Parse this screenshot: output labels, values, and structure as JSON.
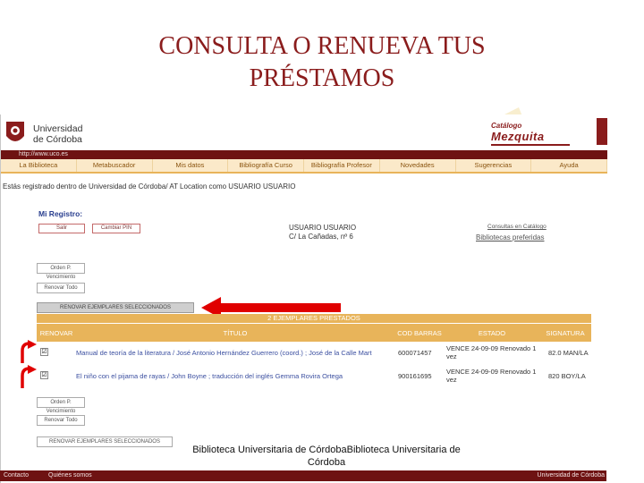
{
  "slide": {
    "title_line1": "CONSULTA O RENUEVA TUS",
    "title_line2": "PRÉSTAMOS",
    "caption": "Biblioteca Universitaria de CórdobaBiblioteca Universitaria de Córdoba"
  },
  "header": {
    "university_line1": "Universidad",
    "university_line2": "de Córdoba",
    "catalog_small": "Catálogo",
    "catalog_big": "Mezquita",
    "url": "http://www.uco.es"
  },
  "nav": {
    "items": [
      "La Biblioteca",
      "Metabuscador",
      "Mis datos",
      "Bibliografía Curso",
      "Bibliografía Profesor",
      "Novedades",
      "Sugerencias",
      "Ayuda"
    ]
  },
  "session": {
    "text": "Estás registrado dentro de Universidad de Córdoba/ AT Location como USUARIO USUARIO"
  },
  "registro": {
    "title": "Mi Registro:",
    "btn_salir": "Salir",
    "btn_cambiar_pin": "Cambiar PIN",
    "user_name": "USUARIO USUARIO",
    "user_address": "C/ La Cañadas, nº 6",
    "consultas": "Consultas en Catálogo",
    "bib_pref": "Bibliotecas preferidas",
    "btn_orden_top": "Orden P. Vencimiento",
    "btn_renovar_todo_top": "Renovar Todo",
    "btn_renovar_sel_top": "RENOVAR EJEMPLARES SELECCIONADOS",
    "btn_orden_bottom": "Orden P. Vencimiento",
    "btn_renovar_todo_bottom": "Renovar Todo",
    "btn_renovar_sel_bottom": "RENOVAR EJEMPLARES SELECCIONADOS"
  },
  "table": {
    "caption": "2 EJEMPLARES PRESTADOS",
    "headers": {
      "renovar": "RENOVAR",
      "titulo": "TÍTULO",
      "cod_barras": "COD BARRAS",
      "estado": "ESTADO",
      "signatura": "SIGNATURA"
    },
    "rows": [
      {
        "checked": "☑",
        "titulo": "Manual de teoría de la literatura / José Antonio Hernández Guerrero (coord.) ; José de la Calle Mart",
        "cod": "600071457",
        "estado": "VENCE 24-09-09 Renovado 1 vez",
        "signatura": "82.0 MAN/LA"
      },
      {
        "checked": "☑",
        "titulo": "El niño con el pijama de rayas / John Boyne ; traducción del inglés Gemma Rovira Ortega",
        "cod": "900161695",
        "estado": "VENCE 24-09-09 Renovado 1 vez",
        "signatura": "820 BOY/LA"
      }
    ]
  },
  "footer": {
    "contacto": "Contacto",
    "quienes": "Quiénes somos",
    "right": "Universidad de Córdoba"
  },
  "colors": {
    "accent_dark_red": "#8a1c1c",
    "nav_bg": "#fbe9c9",
    "table_header": "#e8b45a",
    "arrow_red": "#e00000",
    "link_blue": "#3b4fa0"
  }
}
